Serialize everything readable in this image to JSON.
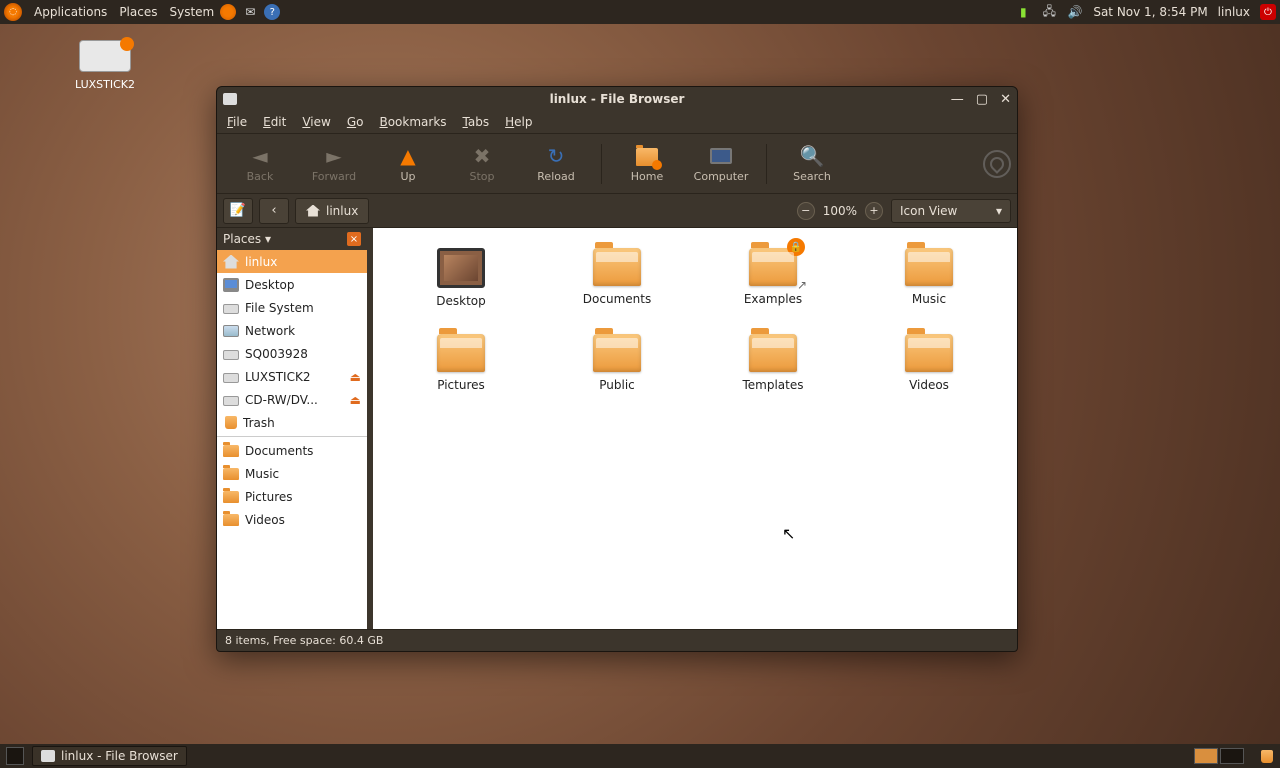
{
  "panel": {
    "menus": [
      "Applications",
      "Places",
      "System"
    ],
    "datetime": "Sat Nov  1,  8:54 PM",
    "username": "linlux"
  },
  "desktop": {
    "drive_label": "LUXSTICK2"
  },
  "window": {
    "title": "linlux - File Browser",
    "menubar": [
      "File",
      "Edit",
      "View",
      "Go",
      "Bookmarks",
      "Tabs",
      "Help"
    ],
    "toolbar": {
      "back": "Back",
      "forward": "Forward",
      "up": "Up",
      "stop": "Stop",
      "reload": "Reload",
      "home": "Home",
      "computer": "Computer",
      "search": "Search"
    },
    "location": {
      "current": "linlux"
    },
    "zoom": "100%",
    "view_mode": "Icon View",
    "sidebar": {
      "header": "Places",
      "places": [
        {
          "label": "linlux",
          "icon": "home",
          "selected": true
        },
        {
          "label": "Desktop",
          "icon": "desktop"
        },
        {
          "label": "File System",
          "icon": "drive"
        },
        {
          "label": "Network",
          "icon": "net"
        },
        {
          "label": "SQ003928",
          "icon": "drive"
        },
        {
          "label": "LUXSTICK2",
          "icon": "drive",
          "eject": true
        },
        {
          "label": "CD-RW/DV...",
          "icon": "drive",
          "eject": true
        },
        {
          "label": "Trash",
          "icon": "trash"
        }
      ],
      "bookmarks": [
        {
          "label": "Documents"
        },
        {
          "label": "Music"
        },
        {
          "label": "Pictures"
        },
        {
          "label": "Videos"
        }
      ]
    },
    "files": [
      {
        "label": "Desktop",
        "kind": "desktop"
      },
      {
        "label": "Documents",
        "kind": "folder"
      },
      {
        "label": "Examples",
        "kind": "folder",
        "locked": true,
        "link": true
      },
      {
        "label": "Music",
        "kind": "folder"
      },
      {
        "label": "Pictures",
        "kind": "folder"
      },
      {
        "label": "Public",
        "kind": "folder"
      },
      {
        "label": "Templates",
        "kind": "folder"
      },
      {
        "label": "Videos",
        "kind": "folder"
      }
    ],
    "status": "8 items, Free space: 60.4 GB"
  },
  "taskbar": {
    "task": "linlux - File Browser"
  }
}
